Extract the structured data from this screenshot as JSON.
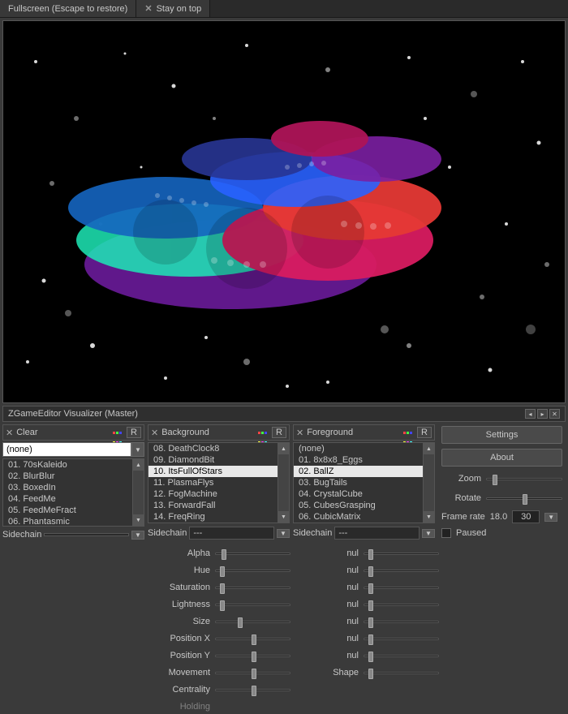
{
  "tabs": {
    "fullscreen": "Fullscreen (Escape to restore)",
    "stayontop": "Stay on top"
  },
  "panel_title": "ZGameEditor Visualizer (Master)",
  "columns": {
    "clear": {
      "title": "Clear",
      "r": "R",
      "selected": "(none)",
      "items": [
        "01. 70sKaleido",
        "02. BlurBlur",
        "03. BoxedIn",
        "04. FeedMe",
        "05. FeedMeFract",
        "06. Phantasmic"
      ],
      "sidechain_label": "Sidechain",
      "sidechain_value": ""
    },
    "background": {
      "title": "Background",
      "r": "R",
      "items": [
        "08. DeathClock8",
        "09. DiamondBit",
        "10. ItsFullOfStars",
        "11. PlasmaFlys",
        "12. FogMachine",
        "13. ForwardFall",
        "14. FreqRing"
      ],
      "selected_index": 2,
      "sidechain_label": "Sidechain",
      "sidechain_value": "---"
    },
    "foreground": {
      "title": "Foreground",
      "r": "R",
      "items": [
        "(none)",
        "01. 8x8x8_Eggs",
        "02. BallZ",
        "03. BugTails",
        "04. CrystalCube",
        "05. CubesGrasping",
        "06. CubicMatrix"
      ],
      "selected_index": 2,
      "sidechain_label": "Sidechain",
      "sidechain_value": "---"
    }
  },
  "right": {
    "settings": "Settings",
    "about": "About",
    "zoom_label": "Zoom",
    "rotate_label": "Rotate",
    "framerate_label": "Frame rate",
    "framerate_value": "18.0",
    "framerate_target": "30",
    "paused_label": "Paused"
  },
  "sliders_bg": [
    "Alpha",
    "Hue",
    "Saturation",
    "Lightness",
    "Size",
    "Position X",
    "Position Y",
    "Movement",
    "Centrality"
  ],
  "sliders_fg": [
    "nul",
    "nul",
    "nul",
    "nul",
    "nul",
    "nul",
    "nul",
    "Shape"
  ],
  "partial_label": "Holding"
}
